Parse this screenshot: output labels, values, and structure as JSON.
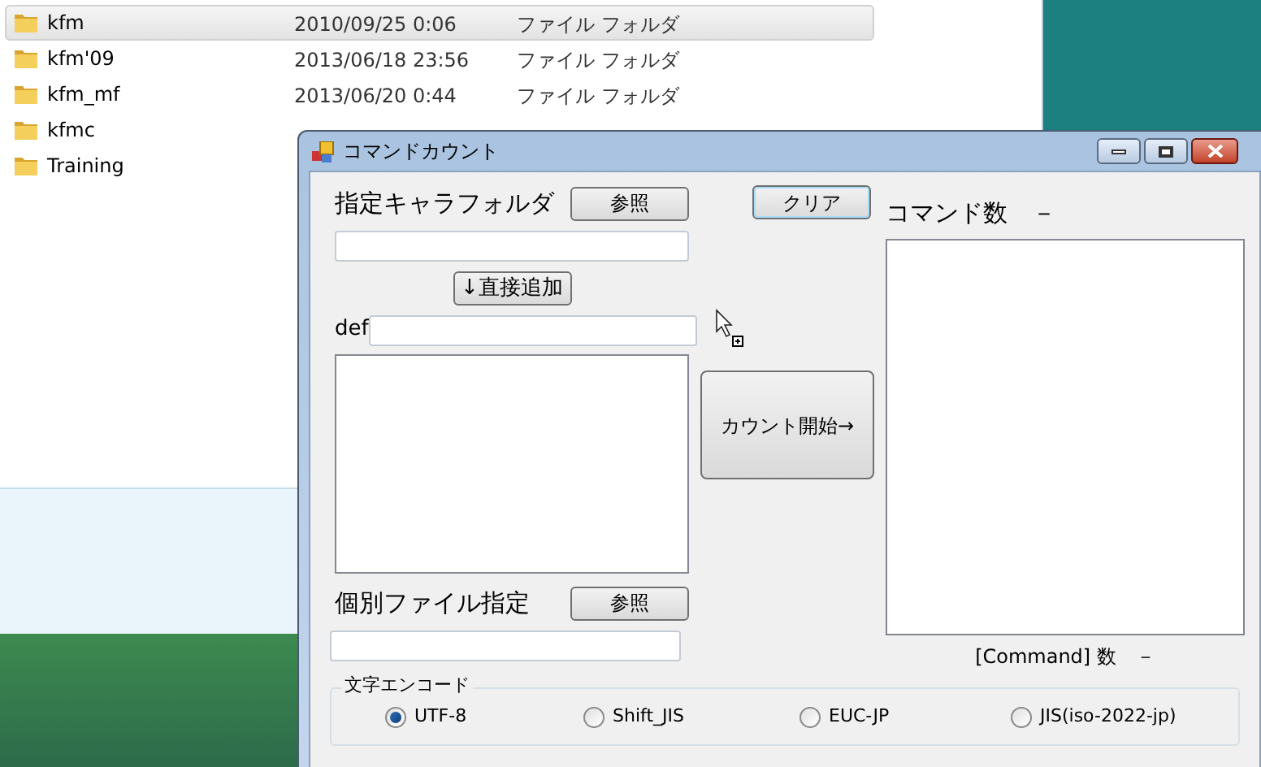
{
  "explorer": {
    "rows": [
      {
        "name": "kfm",
        "date": "2010/09/25 0:06",
        "type": "ファイル フォルダ",
        "selected": true
      },
      {
        "name": "kfm'09",
        "date": "2013/06/18 23:56",
        "type": "ファイル フォルダ",
        "selected": false
      },
      {
        "name": "kfm_mf",
        "date": "2013/06/20 0:44",
        "type": "ファイル フォルダ",
        "selected": false
      },
      {
        "name": "kfmc",
        "selected": false
      },
      {
        "name": "Training",
        "selected": false
      }
    ]
  },
  "window": {
    "title": "コマンドカウント",
    "folder_label": "指定キャラフォルダ",
    "folder_browse": "参照",
    "clear_button": "クリア",
    "add_button": "↓直接追加",
    "def_label": "def",
    "start_button": "カウント開始→",
    "file_label": "個別ファイル指定",
    "file_browse": "参照",
    "command_count_label": "コマンド数　－",
    "command_count_footer": "[Command] 数　－",
    "encoding": {
      "title": "文字エンコード",
      "options": [
        {
          "label": "UTF-8",
          "selected": true
        },
        {
          "label": "Shift_JIS",
          "selected": false
        },
        {
          "label": "EUC-JP",
          "selected": false
        },
        {
          "label": "JIS(iso-2022-jp)",
          "selected": false
        }
      ]
    }
  }
}
